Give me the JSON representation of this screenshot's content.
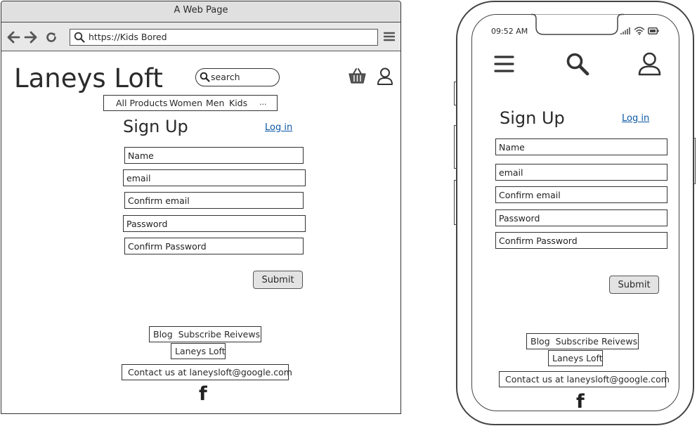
{
  "desktop": {
    "window_title": "A Web Page",
    "url": "https://Kids Bored",
    "site_title": "Laneys Loft",
    "search_placeholder": "search",
    "nav": {
      "items": [
        "All Products",
        "Women",
        "Men",
        "Kids"
      ],
      "more": "..."
    },
    "signup": {
      "heading": "Sign Up",
      "login_link": "Log in",
      "fields": [
        "Name",
        "email",
        "Confirm email",
        "Password",
        "Confirm Password"
      ],
      "submit": "Submit"
    },
    "footer": {
      "links": "Blog  Subscribe Reivews",
      "brand": "Laneys Loft",
      "contact": "Contact us at laneysloft@google.com",
      "social": "f"
    }
  },
  "mobile": {
    "status_time": "09:52 AM",
    "signup": {
      "heading": "Sign Up",
      "login_link": "Log in",
      "fields": [
        "Name",
        "email",
        "Confirm email",
        "Password",
        "Confirm Password"
      ],
      "submit": "Submit"
    },
    "footer": {
      "links": "Blog  Subscribe Reivews",
      "brand": "Laneys Loft",
      "contact": "Contact us at laneysloft@google.com",
      "social": "f"
    }
  }
}
